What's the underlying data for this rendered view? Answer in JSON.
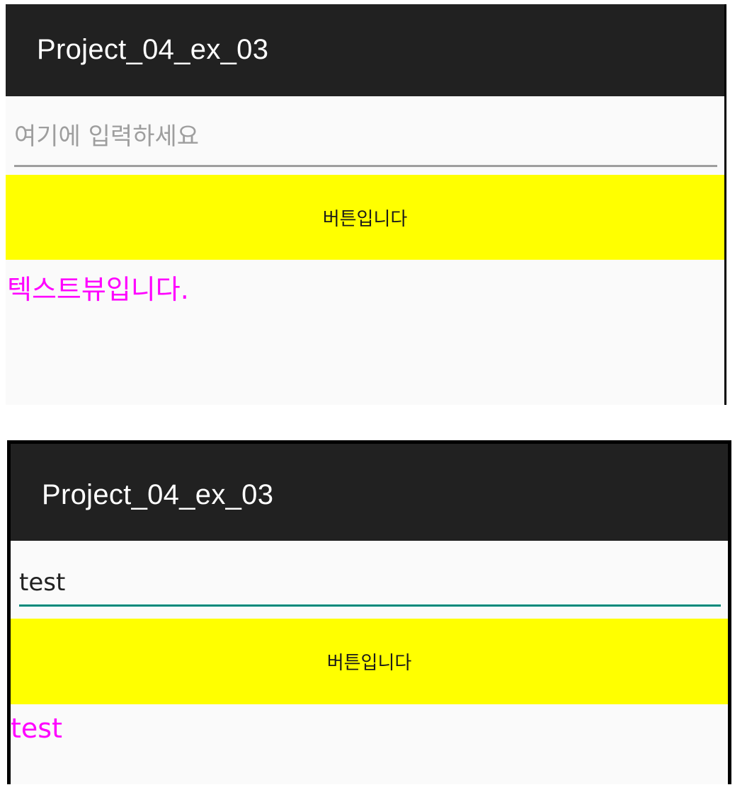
{
  "screens": [
    {
      "app_title": "Project_04_ex_03",
      "edit_text": {
        "value": "",
        "placeholder": "여기에 입력하세요",
        "underline_color": "#9e9e9e"
      },
      "button_label": "버튼입니다",
      "text_view": "텍스트뷰입니다."
    },
    {
      "app_title": "Project_04_ex_03",
      "edit_text": {
        "value": "test",
        "placeholder": "",
        "underline_color": "#00897b"
      },
      "button_label": "버튼입니다",
      "text_view": "test"
    }
  ],
  "colors": {
    "app_bar": "#212121",
    "button_bg": "#ffff00",
    "text_view": "#ff00ff"
  }
}
